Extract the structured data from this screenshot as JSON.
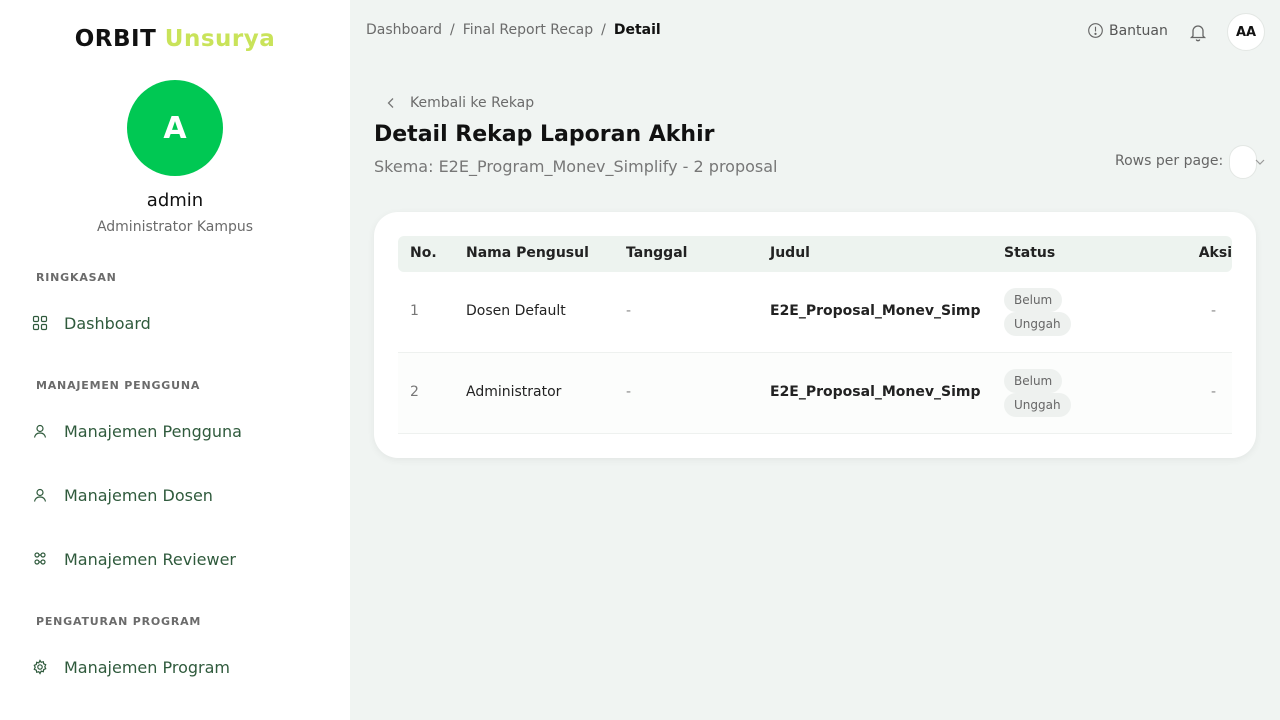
{
  "brand": {
    "part1": "ORBIT",
    "part2": "Unsurya"
  },
  "user": {
    "initial": "A",
    "name": "admin",
    "role": "Administrator Kampus"
  },
  "sidebar": {
    "sections": [
      {
        "label": "RINGKASAN"
      },
      {
        "label": "MANAJEMEN PENGGUNA"
      },
      {
        "label": "PENGATURAN PROGRAM"
      }
    ],
    "items": [
      {
        "label": "Dashboard",
        "icon": "grid-icon"
      },
      {
        "label": "Manajemen Pengguna",
        "icon": "user-icon"
      },
      {
        "label": "Manajemen Dosen",
        "icon": "user-icon"
      },
      {
        "label": "Manajemen Reviewer",
        "icon": "users-group-icon"
      },
      {
        "label": "Manajemen Program",
        "icon": "gear-icon"
      }
    ]
  },
  "breadcrumb": {
    "items": [
      "Dashboard",
      "Final Report Recap"
    ],
    "current": "Detail",
    "separator": "/"
  },
  "topbar": {
    "help_label": "Bantuan",
    "avatar_initials": "AA"
  },
  "header": {
    "back_label": "Kembali ke Rekap",
    "title": "Detail Rekap Laporan Akhir",
    "subtitle": "Skema: E2E_Program_Monev_Simplify - 2 proposal",
    "rows_per_page_label": "Rows per page:"
  },
  "table": {
    "columns": [
      "No.",
      "Nama Pengusul",
      "Tanggal",
      "Judul",
      "Status",
      "Aksi"
    ],
    "rows": [
      {
        "no": "1",
        "nama": "Dosen Default",
        "tanggal": "-",
        "judul": "E2E_Proposal_Monev_Simplify",
        "status_line1": "Belum",
        "status_line2": "Unggah",
        "aksi": "-"
      },
      {
        "no": "2",
        "nama": "Administrator",
        "tanggal": "-",
        "judul": "E2E_Proposal_Monev_Simplify",
        "status_line1": "Belum",
        "status_line2": "Unggah",
        "aksi": "-"
      }
    ]
  },
  "colors": {
    "accent": "#00c853",
    "brand_secondary": "#c9e35a",
    "nav_text": "#2f5a3c",
    "background": "#f0f4f2"
  }
}
